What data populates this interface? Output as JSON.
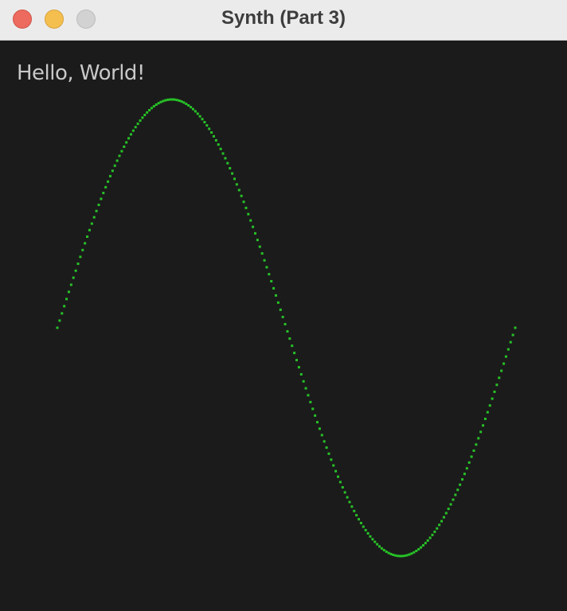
{
  "window": {
    "title": "Synth (Part 3)"
  },
  "content": {
    "greeting": "Hello, World!"
  },
  "waveform": {
    "shape": "sine",
    "cycles": 1,
    "sample_count": 200,
    "color": "#27c227"
  },
  "colors": {
    "background": "#1b1b1b",
    "text": "#c8c8c8",
    "close": "#ed6a5e",
    "minimize": "#f5bf4f",
    "zoom": "#d2d2d2"
  }
}
